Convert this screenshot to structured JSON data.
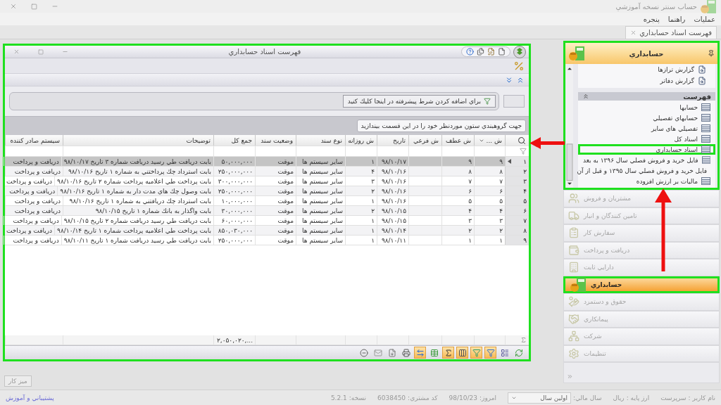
{
  "app_title": "حساب سنتر نسخه آموزشي",
  "menu": [
    "عمليات",
    "راهنما",
    "پنجره"
  ],
  "document_tab": {
    "label": "فهرست اسناد حسابداري"
  },
  "window": {
    "title": "فهرست اسناد حسابداري",
    "annotated": true,
    "filter_button": "براي اضافه كردن شرط پيشرفته در اينجا كليك كنيد",
    "group_panel": "جهت گروهبندي ستون موردنظر خود را در اين قسمت بيندازيد",
    "table": {
      "columns": [
        "ش ...",
        "ش عطف",
        "ش فرعي",
        "تاريخ",
        "ش روزانه",
        "نوع سند",
        "وضعيت سند",
        "جمع كل",
        "توضيحات",
        "سيستم صادر كننده"
      ],
      "rows": [
        {
          "number": "۱",
          "selected": true,
          "cells": [
            "۹",
            "۹",
            null,
            "۹۸/۱۰/۱۷",
            "۱",
            "ساير سيستم ها",
            "موقت",
            "۵۰,۰۰۰,۰۰۰",
            "بابت دريافت طي رسيد دريافت شماره ۳ تاريخ ۹۸/۱۰/۱۷",
            "دريافت و پرداخت"
          ]
        },
        {
          "number": "۲",
          "selected": false,
          "cells": [
            "۸",
            "۸",
            null,
            "۹۸/۱۰/۱۶",
            "۴",
            "ساير سيستم ها",
            "موقت",
            "۲۵۰,۰۰۰,۰۰۰",
            "بابت استرداد چك پرداختني به شماره ۱ تاريخ ۹۸/۱۰/۱۶",
            "دريافت و پرداخت"
          ]
        },
        {
          "number": "۳",
          "selected": false,
          "cells": [
            "۷",
            "۷",
            null,
            "۹۸/۱۰/۱۶",
            "۳",
            "ساير سيستم ها",
            "موقت",
            "۳۰۰,۰۰۰,۰۰۰",
            "بابت پرداخت طي اعلاميه پرداخت شماره ۲ تاريخ ۹۸/۱۰/۱۶",
            "دريافت و پرداخت"
          ]
        },
        {
          "number": "۴",
          "selected": false,
          "cells": [
            "۶",
            "۶",
            null,
            "۹۸/۱۰/۱۶",
            "۲",
            "ساير سيستم ها",
            "موقت",
            "۲۵۰,۰۰۰,۰۰۰",
            "بابت وصول چك هاي مدت دار به شماره ۱ تاريخ ۹۸/۱۰/۱۶",
            "دريافت و پرداخت"
          ]
        },
        {
          "number": "۵",
          "selected": false,
          "cells": [
            "۵",
            "۵",
            null,
            "۹۸/۱۰/۱۶",
            "۱",
            "ساير سيستم ها",
            "موقت",
            "۱۰,۰۰۰,۰۰۰",
            "بابت استرداد چك دريافتني به شماره ۱ تاريخ ۹۸/۱۰/۱۶",
            "دريافت و پرداخت"
          ]
        },
        {
          "number": "۶",
          "selected": false,
          "cells": [
            "۴",
            "۴",
            null,
            "۹۸/۱۰/۱۵",
            "۲",
            "ساير سيستم ها",
            "موقت",
            "۳۰,۰۰۰,۰۰۰",
            "بابت واگذار به بانك شماره ۱ تاريخ ۹۸/۱۰/۱۵",
            "دريافت و پرداخت"
          ]
        },
        {
          "number": "۷",
          "selected": false,
          "cells": [
            "۳",
            "۳",
            null,
            "۹۸/۱۰/۱۵",
            "۱",
            "ساير سيستم ها",
            "موقت",
            "۶۰,۰۰۰,۰۰۰",
            "بابت دريافت طي رسيد دريافت شماره ۲ تاريخ ۹۸/۱۰/۱۵",
            "دريافت و پرداخت"
          ]
        },
        {
          "number": "۸",
          "selected": false,
          "cells": [
            "۲",
            "۲",
            null,
            "۹۸/۱۰/۱۴",
            "۱",
            "ساير سيستم ها",
            "موقت",
            "۸۵۰,۰۳۰,۰۰۰",
            "بابت پرداخت طي اعلاميه پرداخت شماره ۱ تاريخ ۹۸/۱۰/۱۴",
            "دريافت و پرداخت"
          ]
        },
        {
          "number": "۹",
          "selected": false,
          "cells": [
            "۱",
            "۱",
            null,
            "۹۸/۱۰/۱۱",
            "۱",
            "ساير سيستم ها",
            "موقت",
            "۲۵۰,۰۰۰,۰۰۰",
            "بابت دريافت طي رسيد دريافت شماره ۱ تاريخ ۹۸/۱۰/۱۱",
            "دريافت و پرداخت"
          ]
        }
      ],
      "total": "...,۲,۰۵۰,۰۲۰"
    },
    "toolbar": [
      {
        "on": false
      },
      {
        "on": false
      },
      {
        "on": true
      },
      {
        "on": true
      },
      {
        "on": true
      },
      {
        "on": true
      },
      {
        "on": false
      },
      {
        "on": true
      },
      {
        "on": false
      },
      {
        "on": false
      },
      {
        "on": false
      },
      {
        "on": false
      }
    ]
  },
  "sidebar": {
    "header": "حسابداري",
    "annotated": true,
    "reports": [
      "گزارش ترازها",
      "گزارش دفاتر"
    ],
    "section": "فهرست",
    "items": [
      {
        "label": "حسابها",
        "annotated": false
      },
      {
        "label": "حسابهاي تفصيلي",
        "annotated": false
      },
      {
        "label": "تفصيلي هاي ساير",
        "annotated": false
      },
      {
        "label": "اسناد كل",
        "annotated": false
      },
      {
        "label": "اسناد حسابداري",
        "annotated": true
      },
      {
        "label": "فايل خريد و فروش فصلي سال ۱۳۹۶ به بعد",
        "annotated": false
      },
      {
        "label": "فايل خريد و فروش فصلي سال ۱۳۹۵ و قبل از آن",
        "annotated": false
      },
      {
        "label": "ماليات بر ارزش افزوده",
        "annotated": false
      }
    ]
  },
  "nav": [
    {
      "label": "مشتريان و فروش",
      "selected": false,
      "annotated": false
    },
    {
      "label": "تامين كنندگان و انبار",
      "selected": false,
      "annotated": false
    },
    {
      "label": "سفارش كار",
      "selected": false,
      "annotated": false
    },
    {
      "label": "دريافت و پرداخت",
      "selected": false,
      "annotated": false
    },
    {
      "label": "دارايي ثابت",
      "selected": false,
      "annotated": false
    },
    {
      "label": "حسابداري",
      "selected": true,
      "annotated": true
    },
    {
      "label": "حقوق و دستمزد",
      "selected": false,
      "annotated": false
    },
    {
      "label": "پيمانكاري",
      "selected": false,
      "annotated": false
    },
    {
      "label": "شركت",
      "selected": false,
      "annotated": false
    },
    {
      "label": "تنظيمات",
      "selected": false,
      "annotated": false
    }
  ],
  "desktop_button": "ميز كار",
  "status_bar": {
    "fields": [
      {
        "kind": "text",
        "label": "نام كاربر :",
        "value": "سرپرست"
      },
      {
        "kind": "text",
        "label": "ارز پايه :",
        "value": "ريال"
      },
      {
        "kind": "select",
        "label": "سال مالي:",
        "value": "اولين سال"
      },
      {
        "kind": "text",
        "label": "امروز:",
        "value": "98/10/23"
      },
      {
        "kind": "text",
        "label": "كد مشتري:",
        "value": "6038450"
      },
      {
        "kind": "text",
        "label": "نسخه:",
        "value": "5.2.1"
      }
    ],
    "link": "پشتيباني و آموزش"
  }
}
